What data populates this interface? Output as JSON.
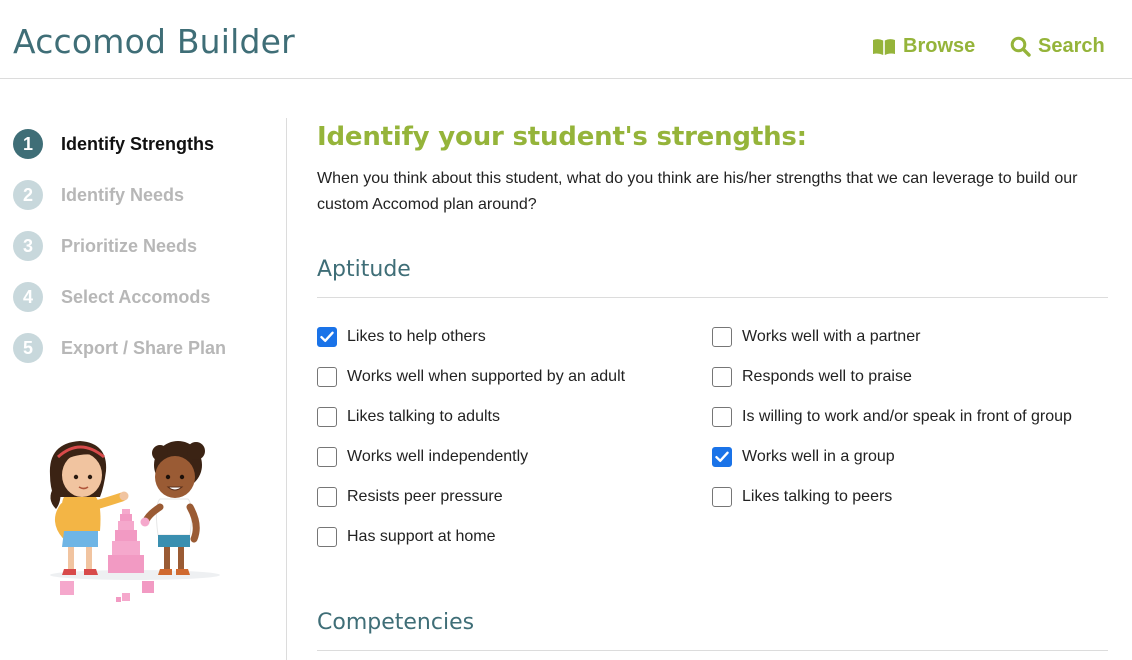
{
  "header": {
    "title": "Accomod Builder",
    "browse_label": "Browse",
    "search_label": "Search"
  },
  "sidebar": {
    "steps": [
      {
        "number": "1",
        "label": "Identify Strengths",
        "active": true
      },
      {
        "number": "2",
        "label": "Identify Needs",
        "active": false
      },
      {
        "number": "3",
        "label": "Prioritize Needs",
        "active": false
      },
      {
        "number": "4",
        "label": "Select Accomods",
        "active": false
      },
      {
        "number": "5",
        "label": "Export / Share Plan",
        "active": false
      }
    ]
  },
  "main": {
    "heading": "Identify your student's strengths:",
    "intro": "When you think about this student, what do you think are his/her strengths that we can leverage to build our custom Accomod plan around?",
    "sections": [
      {
        "title": "Aptitude",
        "left_items": [
          {
            "label": "Likes to help others",
            "checked": true
          },
          {
            "label": "Works well when supported by an adult",
            "checked": false
          },
          {
            "label": "Likes talking to adults",
            "checked": false
          },
          {
            "label": "Works well independently",
            "checked": false
          },
          {
            "label": "Resists peer pressure",
            "checked": false
          },
          {
            "label": "Has support at home",
            "checked": false
          }
        ],
        "right_items": [
          {
            "label": "Works well with a partner",
            "checked": false
          },
          {
            "label": "Responds well to praise",
            "checked": false
          },
          {
            "label": "Is willing to work and/or speak in front of group",
            "checked": false
          },
          {
            "label": "Works well in a group",
            "checked": true
          },
          {
            "label": "Likes talking to peers",
            "checked": false
          }
        ]
      },
      {
        "title": "Competencies"
      }
    ]
  },
  "colors": {
    "brand_teal": "#3f6e77",
    "accent_green": "#95b43a",
    "checkbox_blue": "#1a73e8",
    "inactive_step": "#c8d8dc"
  },
  "icons": {
    "browse": "open-book-icon",
    "search": "magnifier-icon"
  }
}
